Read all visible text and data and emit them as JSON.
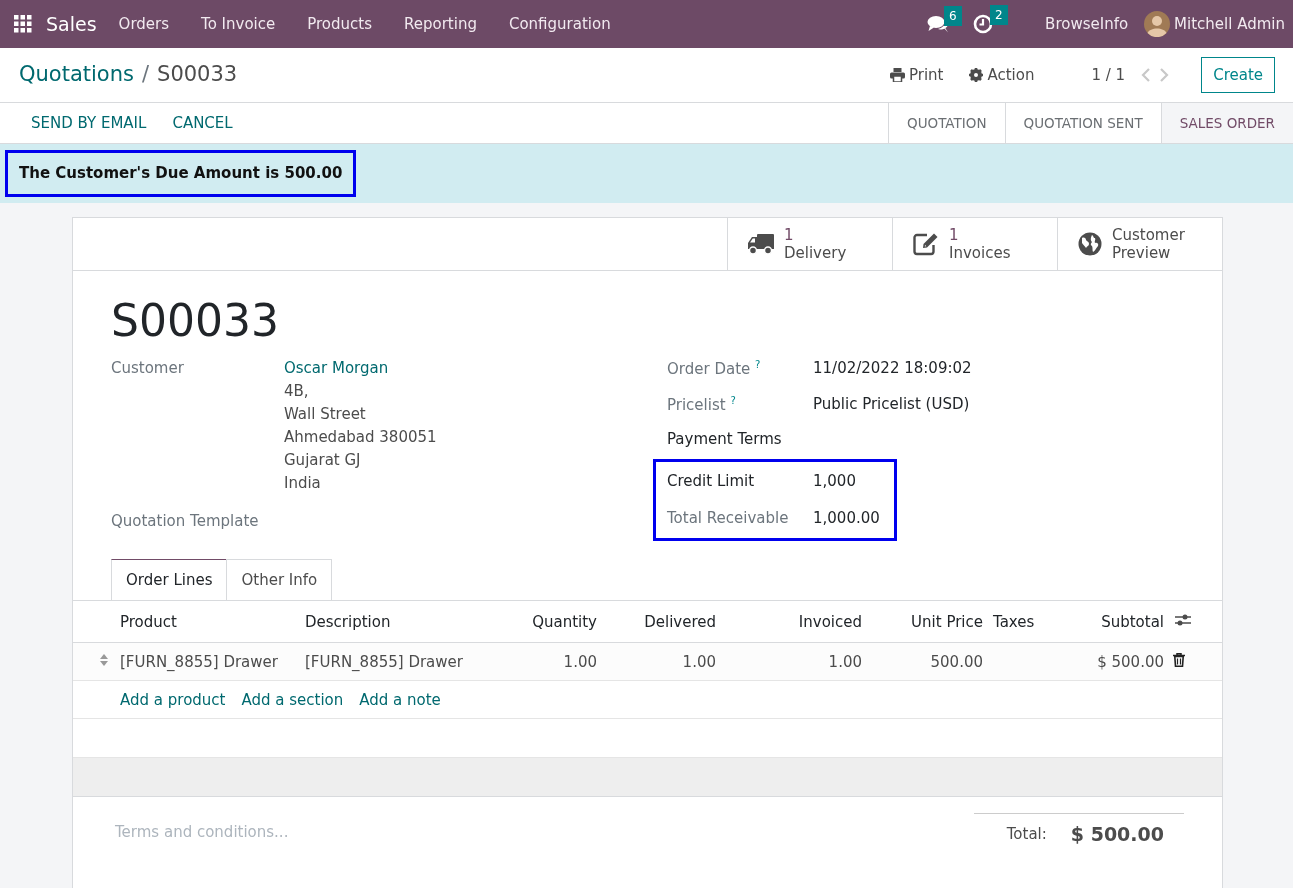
{
  "navbar": {
    "app": "Sales",
    "menus": [
      "Orders",
      "To Invoice",
      "Products",
      "Reporting",
      "Configuration"
    ],
    "messages_count": "6",
    "activities_count": "2",
    "company": "BrowseInfo",
    "user": "Mitchell Admin"
  },
  "breadcrumb": {
    "parent": "Quotations",
    "separator": "/",
    "current": "S00033"
  },
  "toolbar": {
    "print": "Print",
    "action": "Action",
    "pager": "1 / 1",
    "create": "Create"
  },
  "actions": [
    "SEND BY EMAIL",
    "CANCEL"
  ],
  "statusbar": [
    {
      "label": "QUOTATION",
      "selected": false
    },
    {
      "label": "QUOTATION SENT",
      "selected": false
    },
    {
      "label": "SALES ORDER",
      "selected": true
    }
  ],
  "alert": {
    "text": "The Customer's Due Amount is 500.00",
    "highlighted": true
  },
  "smart_buttons": [
    {
      "kind": "delivery",
      "count": "1",
      "label": "Delivery"
    },
    {
      "kind": "invoices",
      "count": "1",
      "label": "Invoices"
    },
    {
      "kind": "preview",
      "label": "Customer Preview"
    }
  ],
  "title": "S00033",
  "customer": {
    "label": "Customer",
    "name": "Oscar Morgan",
    "address": [
      "4B,",
      "Wall Street",
      "Ahmedabad 380051",
      "Gujarat GJ",
      "India"
    ]
  },
  "quotation_template": {
    "label": "Quotation Template"
  },
  "right_fields": [
    {
      "label": "Order Date",
      "help": "?",
      "value": "11/02/2022 18:09:02",
      "strong": false
    },
    {
      "label": "Pricelist",
      "help": "?",
      "value": "Public Pricelist (USD)",
      "strong": false
    },
    {
      "label": "Payment Terms",
      "strong": true
    }
  ],
  "credit": {
    "highlighted": true,
    "fields": [
      {
        "label": "Credit Limit",
        "value": "1,000",
        "strong": true
      },
      {
        "label": "Total Receivable",
        "value": "1,000.00",
        "strong": false
      }
    ]
  },
  "tabs": [
    {
      "label": "Order Lines",
      "selected": true
    },
    {
      "label": "Other Info",
      "selected": false
    }
  ],
  "table": {
    "columns": [
      "Product",
      "Description",
      "Quantity",
      "Delivered",
      "Invoiced",
      "Unit Price",
      "Taxes",
      "Subtotal"
    ],
    "rows": [
      {
        "cells": [
          "[FURN_8855] Drawer",
          "[FURN_8855] Drawer",
          "1.00",
          "1.00",
          "1.00",
          "500.00",
          "",
          "$ 500.00"
        ]
      }
    ],
    "add_links": [
      "Add a product",
      "Add a section",
      "Add a note"
    ]
  },
  "footer": {
    "terms_placeholder": "Terms and conditions...",
    "total_label": "Total:",
    "total": "$ 500.00"
  }
}
